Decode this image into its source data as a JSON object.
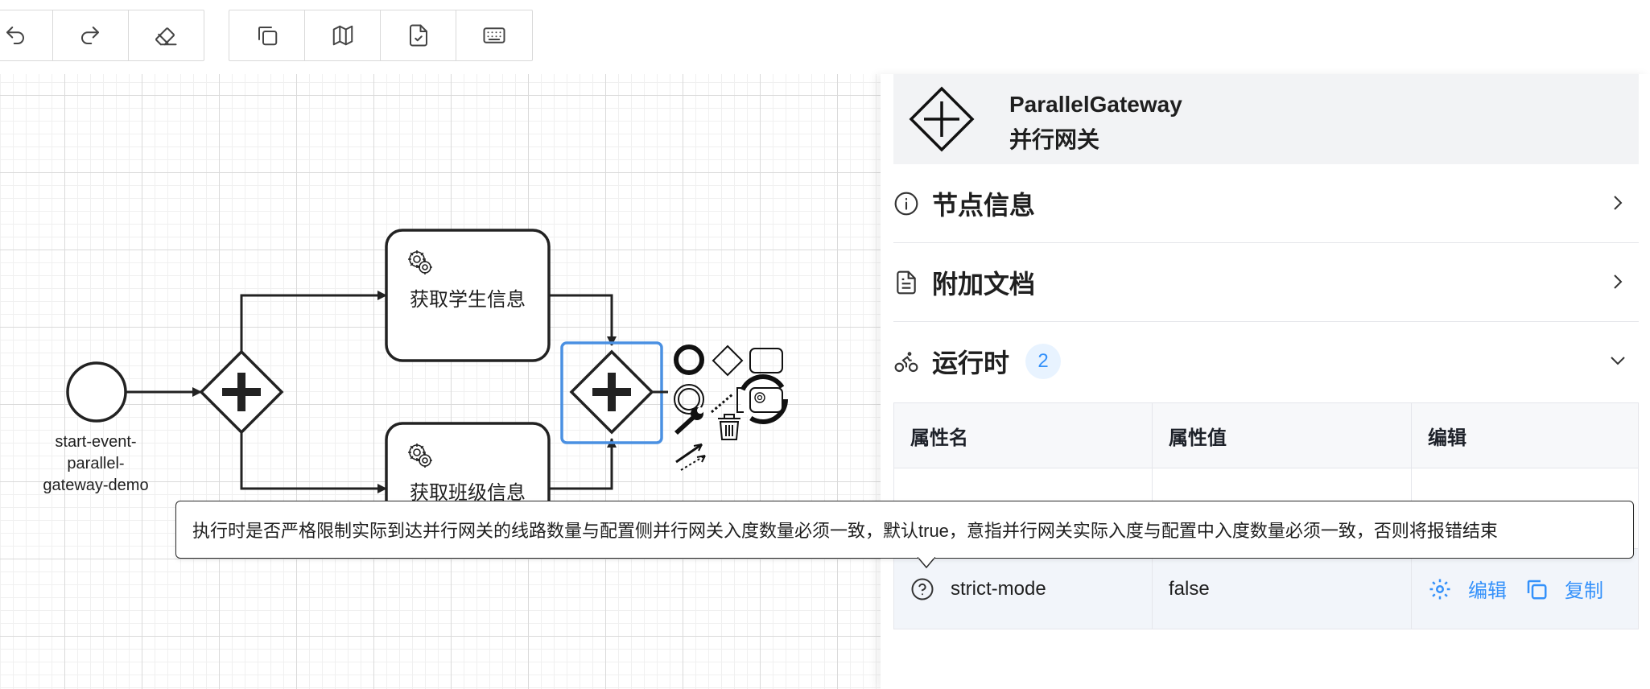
{
  "toolbar": {
    "group1": [
      {
        "icon": "undo-icon",
        "label": "undo"
      },
      {
        "icon": "redo-icon",
        "label": "redo"
      },
      {
        "icon": "eraser-icon",
        "label": "clear"
      }
    ],
    "group2": [
      {
        "icon": "copy-icon",
        "label": "copy"
      },
      {
        "icon": "map-icon",
        "label": "minimap"
      },
      {
        "icon": "file-check-icon",
        "label": "validate"
      },
      {
        "icon": "keyboard-icon",
        "label": "keyboard"
      }
    ]
  },
  "diagram": {
    "start_event_label_lines": [
      "start-event-",
      "parallel-",
      "gateway-demo"
    ],
    "task1_label": "获取学生信息",
    "task2_label": "获取班级信息",
    "context_pad_icons": [
      "end-event-icon",
      "gateway-icon",
      "task-icon",
      "intermediate-event-icon",
      "connect-icon",
      "service-task-icon",
      "wrench-icon",
      "trash-icon",
      "sequence-flow-icon"
    ]
  },
  "panel": {
    "element_type": "ParallelGateway",
    "element_type_zh": "并行网关",
    "sections": [
      {
        "title": "节点信息",
        "icon": "info-icon",
        "expanded": false
      },
      {
        "title": "附加文档",
        "icon": "document-icon",
        "expanded": false
      },
      {
        "title": "运行时",
        "icon": "bike-icon",
        "expanded": true,
        "count": "2"
      }
    ],
    "table": {
      "columns": [
        "属性名",
        "属性值",
        "编辑"
      ],
      "rows": [
        {
          "name": "strict-mode",
          "value": "false",
          "actions": [
            "编辑",
            "复制"
          ]
        }
      ]
    }
  },
  "tooltip": "执行时是否严格限制实际到达并行网关的线路数量与配置侧并行网关入度数量必须一致，默认true，意指并行网关实际入度与配置中入度数量必须一致，否则将报错结束",
  "colors": {
    "accent": "#3491fa",
    "selection": "#4a90e2",
    "stroke": "#222222",
    "header_bg": "#f2f3f5"
  }
}
